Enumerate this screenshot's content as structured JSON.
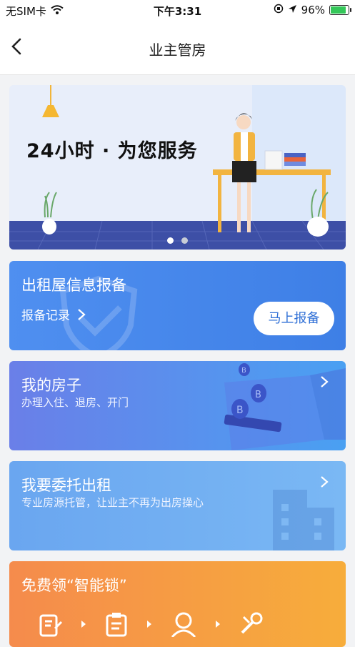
{
  "status_bar": {
    "carrier": "无SIM卡",
    "time": "下午3:31",
    "battery": "96%",
    "battery_level": 0.96
  },
  "nav": {
    "title": "业主管房",
    "back_icon": "chevron-left-icon"
  },
  "banner": {
    "slogan": "24小时 · 为您服务",
    "slide_count": 2,
    "active_slide": 1
  },
  "cards": {
    "rental_report": {
      "title": "出租屋信息报备",
      "records_label": "报备记录",
      "button_label": "马上报备"
    },
    "my_house": {
      "title": "我的房子",
      "subtitle": "办理入住、退房、开门"
    },
    "entrust_rent": {
      "title": "我要委托出租",
      "subtitle": "专业房源托管，让业主不再为出房操心"
    },
    "smart_lock": {
      "title": "免费领“智能锁”"
    }
  },
  "colors": {
    "accent_blue": "#3e7fe6",
    "orange": "#f58b4c",
    "battery_green": "#34c759"
  }
}
